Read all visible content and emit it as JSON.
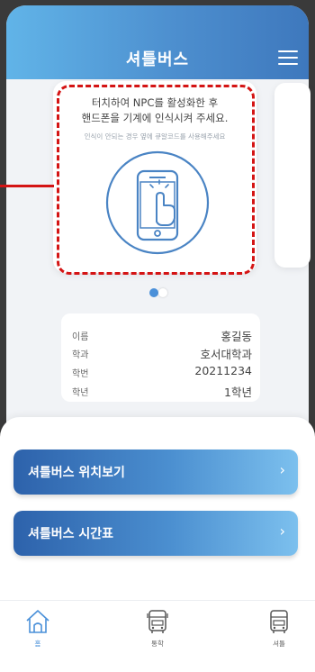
{
  "header": {
    "title": "셔틀버스"
  },
  "nfc_card": {
    "line1": "터치하여 NPC를 활성화한 후",
    "line2": "핸드폰을 기계에 인식시켜 주세요.",
    "subtext": "인식이 안되는 경우 옆에 큐알코드를 사용해주세요",
    "illustration_icon": "phone-tap-icon"
  },
  "carousel": {
    "active_page": 1,
    "page_count": 2
  },
  "student_info": {
    "rows": [
      {
        "label": "이름",
        "value": "홍길동"
      },
      {
        "label": "학과",
        "value": "호서대학과"
      },
      {
        "label": "학번",
        "value": "20211234"
      },
      {
        "label": "학년",
        "value": "1학년"
      }
    ]
  },
  "actions": [
    {
      "label": "셔틀버스 위치보기",
      "chevron": "›"
    },
    {
      "label": "셔틀버스 시간표",
      "chevron": "›"
    }
  ],
  "tabs": [
    {
      "label": "홈",
      "icon": "home-icon",
      "active": true
    },
    {
      "label": "통학",
      "icon": "bus-icon",
      "active": false
    },
    {
      "label": "셔틀",
      "icon": "shuttle-icon",
      "active": false
    }
  ],
  "colors": {
    "accent": "#4a90d9",
    "highlight": "#d41414",
    "header_start": "#61b4e8",
    "header_end": "#3e78bd"
  }
}
